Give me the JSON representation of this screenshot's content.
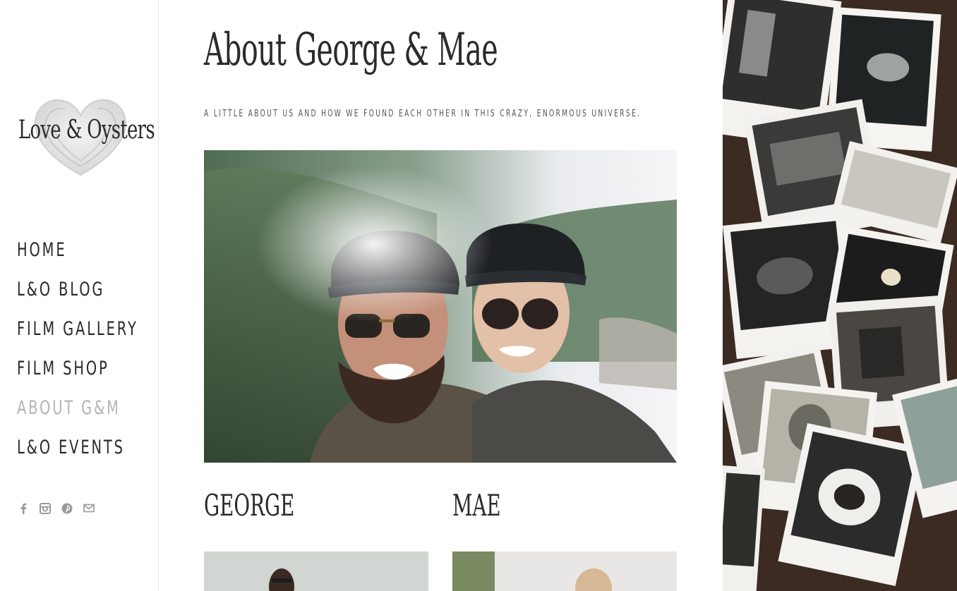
{
  "site": {
    "logo_text": "Love & Oysters"
  },
  "nav": {
    "items": [
      {
        "label": "HOME"
      },
      {
        "label": "L&O BLOG"
      },
      {
        "label": "FILM GALLERY"
      },
      {
        "label": "FILM SHOP"
      },
      {
        "label": "ABOUT G&M",
        "active": true
      },
      {
        "label": "L&O EVENTS"
      }
    ]
  },
  "social": {
    "icons": [
      "facebook-icon",
      "instagram-icon",
      "pinterest-icon",
      "email-icon"
    ]
  },
  "page": {
    "title": "About George & Mae",
    "subtitle": "A little about us and how we found each other in this crazy, enormous universe."
  },
  "people": {
    "george": {
      "name": "GEORGE"
    },
    "mae": {
      "name": "MAE"
    }
  },
  "colors": {
    "text": "#2a2a2a",
    "nav_active": "#b4b4b4",
    "divider": "#e6e6e6",
    "icon": "#9a9a9a"
  }
}
